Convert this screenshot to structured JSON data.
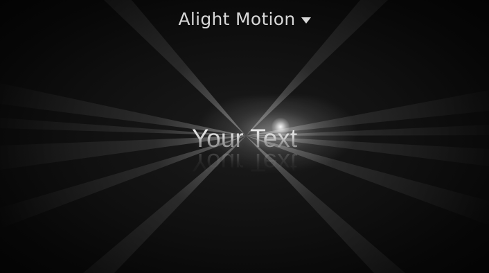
{
  "header": {
    "app_title": "Alight Motion",
    "dropdown_icon": "chevron-down-icon"
  },
  "canvas": {
    "main_text": "Your Text",
    "reflection_text": "Your Text",
    "colors": {
      "background": "#000000",
      "text": "#dcdcdc",
      "glow": "#ffffff"
    }
  }
}
